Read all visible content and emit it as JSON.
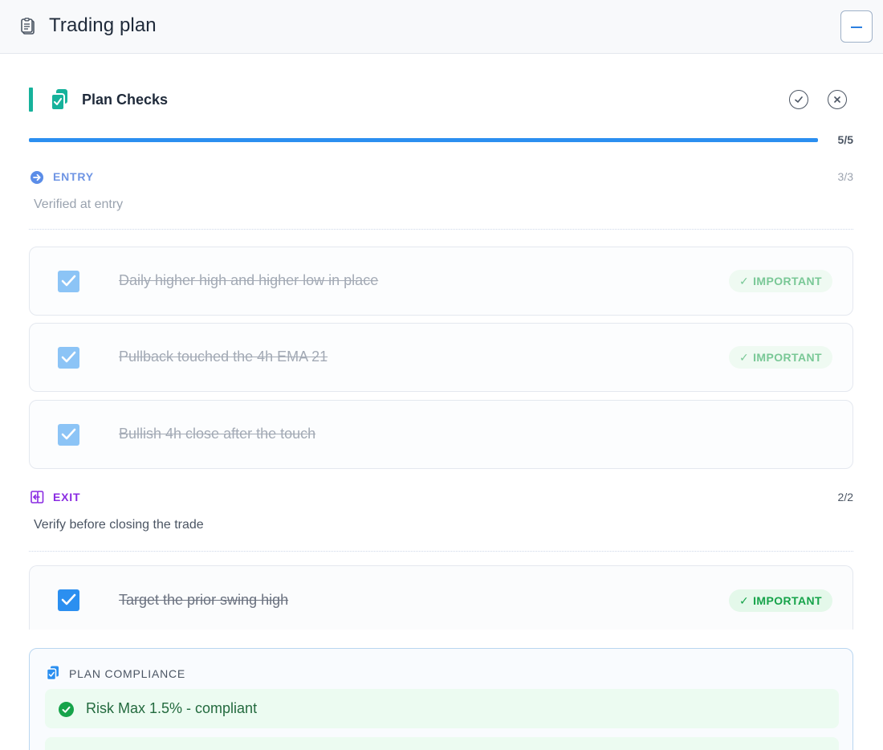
{
  "window": {
    "title": "Trading plan"
  },
  "plan": {
    "title": "Plan Checks",
    "progress": {
      "label": "5/5",
      "fraction": 1.0
    }
  },
  "sections": [
    {
      "title": "ENTRY",
      "count": "3/3",
      "description": "Verified at entry",
      "items": [
        {
          "text": "Daily higher high and higher low in place",
          "badge": "IMPORTANT",
          "checked": true
        },
        {
          "text": "Pullback touched the 4h EMA 21",
          "badge": "IMPORTANT",
          "checked": true
        },
        {
          "text": "Bullish 4h close after the touch",
          "checked": true
        }
      ]
    },
    {
      "title": "EXIT",
      "count": "2/2",
      "description": "Verify before closing the trade",
      "items": [
        {
          "text": "Target the prior swing high",
          "badge": "IMPORTANT",
          "checked": true
        }
      ]
    }
  ],
  "compliance": {
    "title": "PLAN COMPLIANCE",
    "items": [
      {
        "text": "Risk Max 1.5% - compliant"
      }
    ]
  },
  "colors": {
    "accent_teal": "#16b29b",
    "progress_blue": "#2b8ff0",
    "entry_blue": "#5b8de8",
    "exit_purple": "#8a2be2",
    "important_green": "#16a34a",
    "checkbox_blue": "#2b8ff0"
  },
  "icons": {
    "header": "clipboard-icon",
    "plan": "clipboard-check-icon",
    "entry": "arrow-right-circle-icon",
    "exit": "exit-door-icon",
    "accept": "check-circle-icon",
    "cancel": "x-circle-icon",
    "compliance": "clipboard-check-icon",
    "ok": "check-circle-filled-icon"
  }
}
